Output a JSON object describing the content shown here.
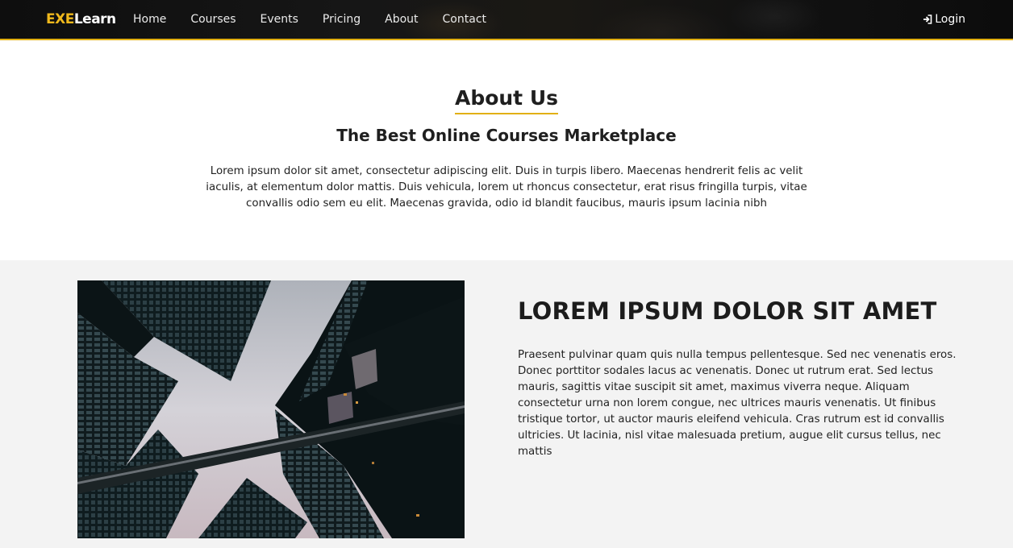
{
  "navbar": {
    "logo_prefix": "EXE",
    "logo_suffix": "Learn",
    "links": [
      "Home",
      "Courses",
      "Events",
      "Pricing",
      "About",
      "Contact"
    ],
    "login_label": "Login",
    "login_icon": "sign-in-icon",
    "accent_color": "#e2b013"
  },
  "about": {
    "title": "About Us",
    "subtitle": "The Best Online Courses Marketplace",
    "text": "Lorem ipsum dolor sit amet, consectetur adipiscing elit. Duis in turpis libero. Maecenas hendrerit felis ac velit iaculis, at elementum dolor mattis. Duis vehicula, lorem ut rhoncus consectetur, erat risus fringilla turpis, vitae convallis odio sem eu elit. Maecenas gravida, odio id blandit faucibus, mauris ipsum lacinia nibh"
  },
  "feature": {
    "image": "skyscrapers-looking-up-photo",
    "title": "LOREM IPSUM DOLOR SIT AMET",
    "text": "Praesent pulvinar quam quis nulla tempus pellentesque. Sed nec venenatis eros. Donec porttitor sodales lacus ac venenatis. Donec ut rutrum erat. Sed lectus mauris, sagittis vitae suscipit sit amet, maximus viverra neque. Aliquam consectetur urna non lorem congue, nec ultrices mauris venenatis. Ut finibus tristique tortor, ut auctor mauris eleifend vehicula. Cras rutrum est id convallis ultricies. Ut lacinia, nisl vitae malesuada pretium, augue elit cursus tellus, nec mattis"
  }
}
